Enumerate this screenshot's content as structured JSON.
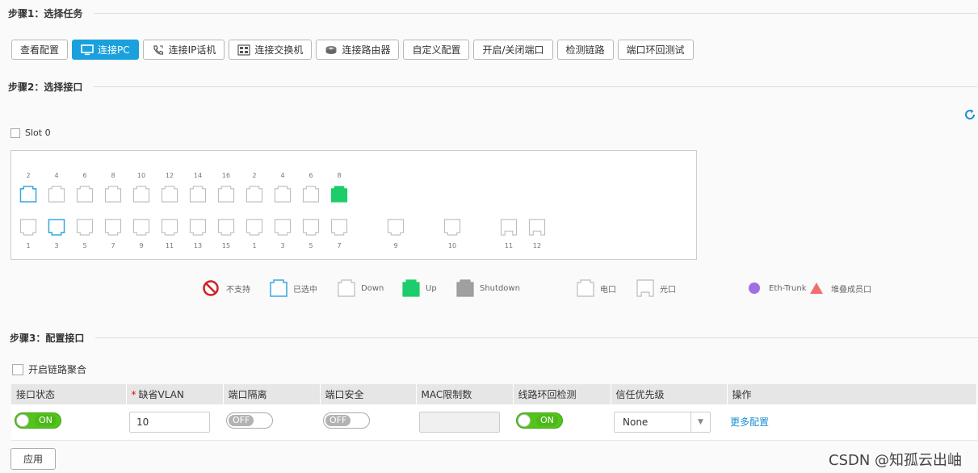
{
  "step1": {
    "title": "步骤1：选择任务"
  },
  "tasks": [
    {
      "label": "查看配置",
      "icon": "",
      "active": false
    },
    {
      "label": "连接PC",
      "icon": "monitor-icon",
      "active": true
    },
    {
      "label": "连接IP话机",
      "icon": "phone-icon",
      "active": false
    },
    {
      "label": "连接交换机",
      "icon": "switch-icon",
      "active": false
    },
    {
      "label": "连接路由器",
      "icon": "router-icon",
      "active": false
    },
    {
      "label": "自定义配置",
      "icon": "",
      "active": false
    },
    {
      "label": "开启/关闭端口",
      "icon": "",
      "active": false
    },
    {
      "label": "检测链路",
      "icon": "",
      "active": false
    },
    {
      "label": "端口环回测试",
      "icon": "",
      "active": false
    }
  ],
  "step2": {
    "title": "步骤2：选择接口",
    "slot_label": "Slot 0",
    "refresh_icon": "refresh-icon"
  },
  "ports": {
    "top_numbers": [
      "2",
      "4",
      "6",
      "8",
      "10",
      "12",
      "14",
      "16",
      "2",
      "4",
      "6",
      "8"
    ],
    "bottom_numbers": [
      "1",
      "3",
      "5",
      "7",
      "9",
      "11",
      "13",
      "15",
      "1",
      "3",
      "5",
      "7"
    ],
    "extra_bottom_numbers": [
      "9",
      "10",
      "11",
      "12"
    ],
    "top_states": [
      "selected",
      "down",
      "down",
      "down",
      "down",
      "down",
      "down",
      "down",
      "down",
      "down",
      "down",
      "up"
    ],
    "bottom_states": [
      "down",
      "selected",
      "down",
      "down",
      "down",
      "down",
      "down",
      "down",
      "down",
      "down",
      "down",
      "down"
    ],
    "extra_states": [
      "down",
      "down",
      "optical",
      "optical"
    ],
    "colors": {
      "selected": "#3aa7e0",
      "down": "#bbbbbb",
      "up": "#1dcc6b",
      "shutdown": "#999999",
      "unsupported": "#cc2222",
      "eth_trunk": "#a070e0",
      "stack": "#f07070"
    }
  },
  "legend": [
    {
      "label": "不支持",
      "icon": "unsupported-icon"
    },
    {
      "label": "已选中",
      "icon": "selected-port-icon"
    },
    {
      "label": "Down",
      "icon": "down-port-icon"
    },
    {
      "label": "Up",
      "icon": "up-port-icon"
    },
    {
      "label": "Shutdown",
      "icon": "shutdown-port-icon"
    },
    {
      "label": "电口",
      "icon": "electric-port-icon"
    },
    {
      "label": "光口",
      "icon": "optical-port-icon"
    },
    {
      "label": "Eth-Trunk",
      "icon": "eth-trunk-icon"
    },
    {
      "label": "堆叠成员口",
      "icon": "stack-member-icon"
    }
  ],
  "step3": {
    "title": "步骤3：配置接口",
    "aggregation_label": "开启链路聚合"
  },
  "table": {
    "headers": [
      "接口状态",
      "缺省VLAN",
      "端口隔离",
      "端口安全",
      "MAC限制数",
      "线路环回检测",
      "信任优先级",
      "操作"
    ],
    "row": {
      "status": "ON",
      "vlan": "10",
      "isolation": "OFF",
      "security": "OFF",
      "mac_limit": "",
      "loop_detect": "ON",
      "trust_priority": "None",
      "action": "更多配置"
    }
  },
  "apply_label": "应用",
  "watermark": "CSDN @知孤云出岫"
}
